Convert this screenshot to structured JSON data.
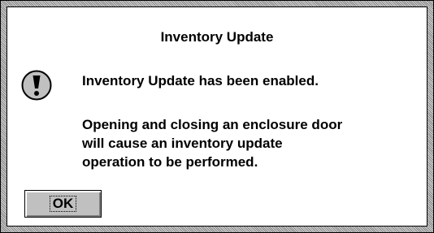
{
  "dialog": {
    "title": "Inventory Update",
    "icon": "exclamation-icon",
    "message_line1": "Inventory Update has been enabled.",
    "message_para": [
      "Opening and closing an enclosure door",
      "will cause an inventory update",
      "operation to be performed."
    ],
    "ok_label": "OK"
  }
}
